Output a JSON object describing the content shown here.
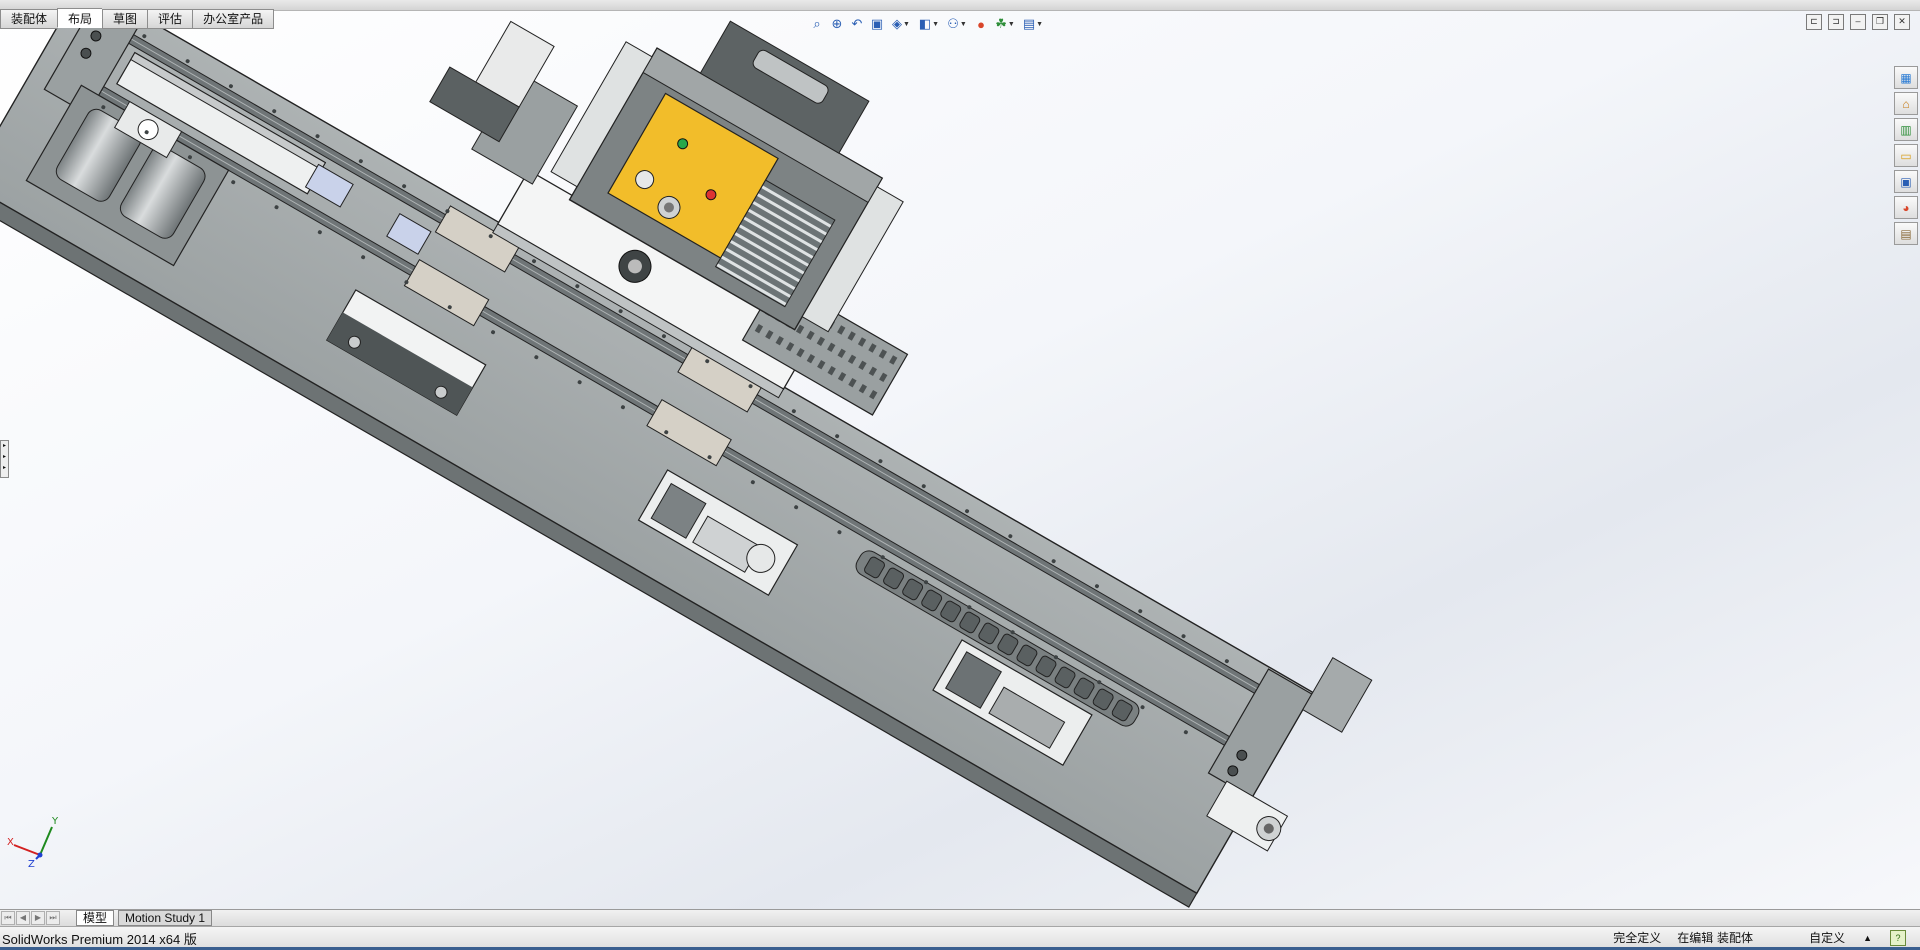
{
  "top_tabs": [
    {
      "label": "装配体",
      "active": false
    },
    {
      "label": "布局",
      "active": true
    },
    {
      "label": "草图",
      "active": false
    },
    {
      "label": "评估",
      "active": false
    },
    {
      "label": "办公室产品",
      "active": false
    }
  ],
  "view_toolbar": {
    "icons": [
      "zoom-to-fit-icon",
      "zoom-to-area-icon",
      "previous-view-icon",
      "section-view-icon",
      "view-orientation-icon",
      "display-style-icon",
      "hide-show-items-icon",
      "edit-appearance-icon",
      "apply-scene-icon",
      "view-settings-icon"
    ]
  },
  "window_controls": [
    "tile-horizontal-icon",
    "tile-vertical-icon",
    "minimize-icon",
    "restore-icon",
    "close-icon"
  ],
  "task_pane": [
    "solidworks-resources-icon",
    "home-icon",
    "design-library-icon",
    "file-explorer-icon",
    "view-palette-icon",
    "appearances-icon",
    "custom-properties-icon"
  ],
  "bottom_tabs": [
    {
      "label": "模型",
      "active": true
    },
    {
      "label": "Motion Study 1",
      "active": false
    }
  ],
  "status": {
    "app": "SolidWorks Premium 2014 x64 版",
    "definition": "完全定义",
    "editing": "在编辑 装配体",
    "units": "自定义",
    "help_icon": "?"
  },
  "triad": {
    "x": "X",
    "y": "Y",
    "z": "Z"
  },
  "colors": {
    "plate": "#a4aaab",
    "plate_dark": "#8a9091",
    "rail": "#6f7577",
    "carriage": "#e9eaea",
    "pcb": "#f2bd2a",
    "heatsink": "#5f6769",
    "edge": "#2a2a2a"
  }
}
